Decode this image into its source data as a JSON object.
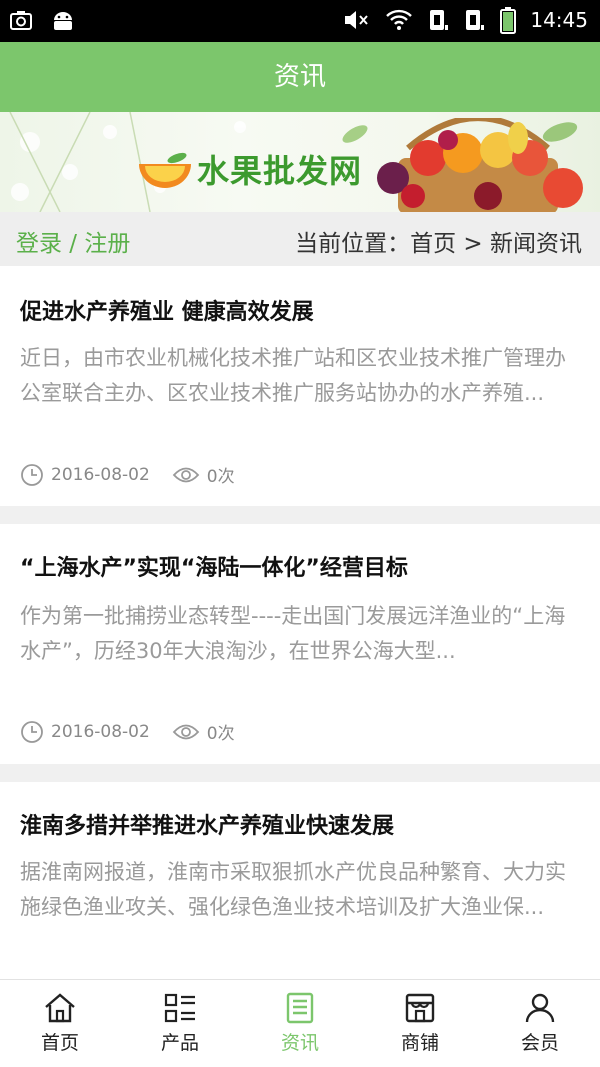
{
  "status": {
    "time": "14:45"
  },
  "header": {
    "title": "资讯"
  },
  "banner": {
    "logo_text": "水果批发网"
  },
  "crumbbar": {
    "login": "登录 / 注册",
    "location": "当前位置：首页 > 新闻资讯"
  },
  "articles": [
    {
      "title": "促进水产养殖业 健康高效发展",
      "summary": "近日，由市农业机械化技术推广站和区农业技术推广管理办公室联合主办、区农业技术推广服务站协办的水产养殖...",
      "date": "2016-08-02",
      "views": "0次"
    },
    {
      "title": "“上海水产”实现“海陆一体化”经营目标",
      "summary": "作为第一批捕捞业态转型----走出国门发展远洋渔业的“上海水产”，历经30年大浪淘沙，在世界公海大型...",
      "date": "2016-08-02",
      "views": "0次"
    },
    {
      "title": "淮南多措并举推进水产养殖业快速发展",
      "summary": "据淮南网报道，淮南市采取狠抓水产优良品种繁育、大力实施绿色渔业攻关、强化绿色渔业技术培训及扩大渔业保...",
      "date": "",
      "views": ""
    }
  ],
  "tabs": [
    {
      "label": "首页",
      "icon": "home-icon"
    },
    {
      "label": "产品",
      "icon": "grid-list-icon"
    },
    {
      "label": "资讯",
      "icon": "news-icon"
    },
    {
      "label": "商铺",
      "icon": "shop-icon"
    },
    {
      "label": "会员",
      "icon": "user-icon"
    }
  ],
  "colors": {
    "accent": "#7cc66c",
    "link_green": "#5bb04a",
    "muted_text": "#9a9a9a"
  }
}
